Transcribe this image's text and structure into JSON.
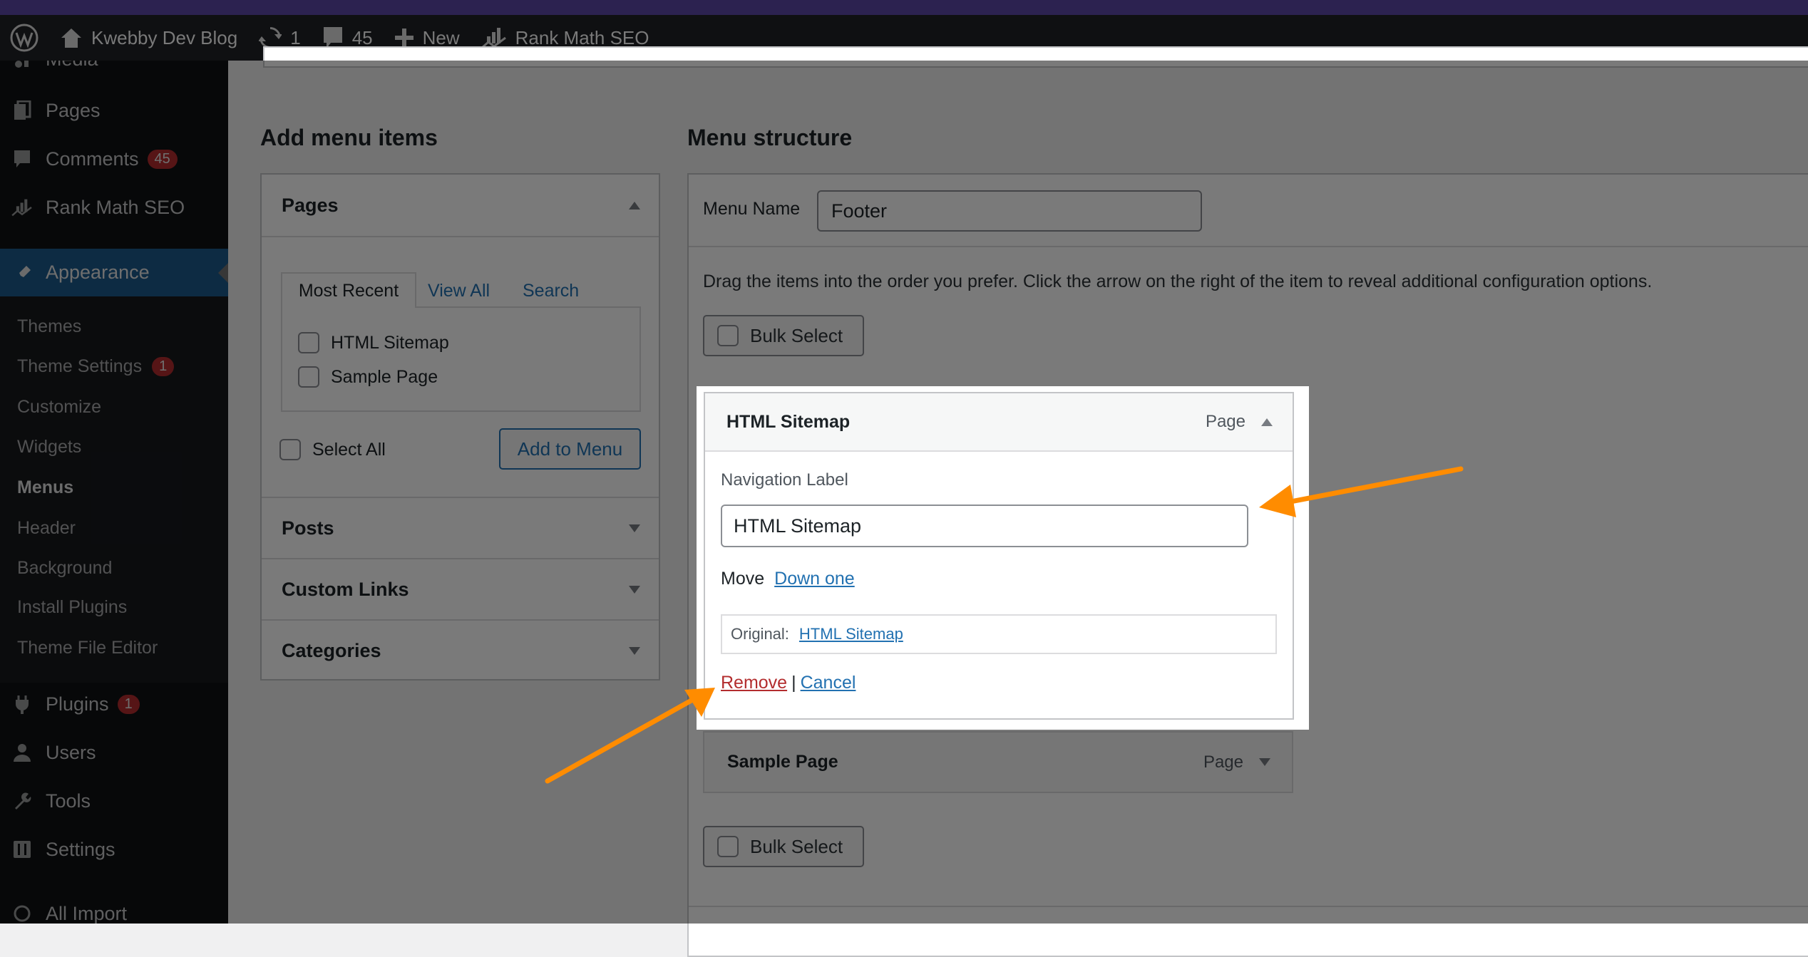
{
  "admin_bar": {
    "site_name": "Kwebby Dev Blog",
    "updates_count": "1",
    "comments_count": "45",
    "new_label": "New",
    "seo_label": "Rank Math SEO"
  },
  "sidebar": {
    "items": [
      {
        "label": "Media",
        "icon": "media-icon"
      },
      {
        "label": "Pages",
        "icon": "pages-icon"
      },
      {
        "label": "Comments",
        "icon": "comments-icon",
        "badge": "45"
      },
      {
        "label": "Rank Math SEO",
        "icon": "rank-math-icon"
      },
      {
        "label": "Appearance",
        "icon": "paintbrush-icon",
        "current": true
      },
      {
        "label": "Plugins",
        "icon": "plugins-icon",
        "badge": "1"
      },
      {
        "label": "Users",
        "icon": "users-icon"
      },
      {
        "label": "Tools",
        "icon": "tools-icon"
      },
      {
        "label": "Settings",
        "icon": "settings-icon"
      },
      {
        "label": "All Import",
        "icon": "import-icon"
      }
    ],
    "submenu": [
      {
        "label": "Themes"
      },
      {
        "label": "Theme Settings",
        "badge": "1"
      },
      {
        "label": "Customize"
      },
      {
        "label": "Widgets"
      },
      {
        "label": "Menus",
        "current": true
      },
      {
        "label": "Header"
      },
      {
        "label": "Background"
      },
      {
        "label": "Install Plugins"
      },
      {
        "label": "Theme File Editor"
      }
    ]
  },
  "add_menu_items": {
    "title": "Add menu items",
    "pages": {
      "title": "Pages",
      "tabs": [
        "Most Recent",
        "View All",
        "Search"
      ],
      "items": [
        "HTML Sitemap",
        "Sample Page"
      ],
      "select_all": "Select All",
      "add_button": "Add to Menu"
    },
    "sections": [
      "Posts",
      "Custom Links",
      "Categories"
    ]
  },
  "menu_structure": {
    "title": "Menu structure",
    "menu_name_label": "Menu Name",
    "menu_name_value": "Footer",
    "instructions": "Drag the items into the order you prefer. Click the arrow on the right of the item to reveal additional configuration options.",
    "bulk_select": "Bulk Select",
    "items": [
      {
        "title": "HTML Sitemap",
        "type": "Page",
        "expanded": true,
        "nav_label_caption": "Navigation Label",
        "nav_label_value": "HTML Sitemap",
        "move_label": "Move",
        "move_link": "Down one",
        "original_label": "Original:",
        "original_link": "HTML Sitemap",
        "remove": "Remove",
        "separator": "|",
        "cancel": "Cancel"
      },
      {
        "title": "Sample Page",
        "type": "Page",
        "expanded": false
      }
    ]
  },
  "colors": {
    "annotation_arrow": "#ff8c00",
    "link": "#2271b1",
    "remove": "#b32d2e",
    "appearance_active": "#2271b1"
  }
}
